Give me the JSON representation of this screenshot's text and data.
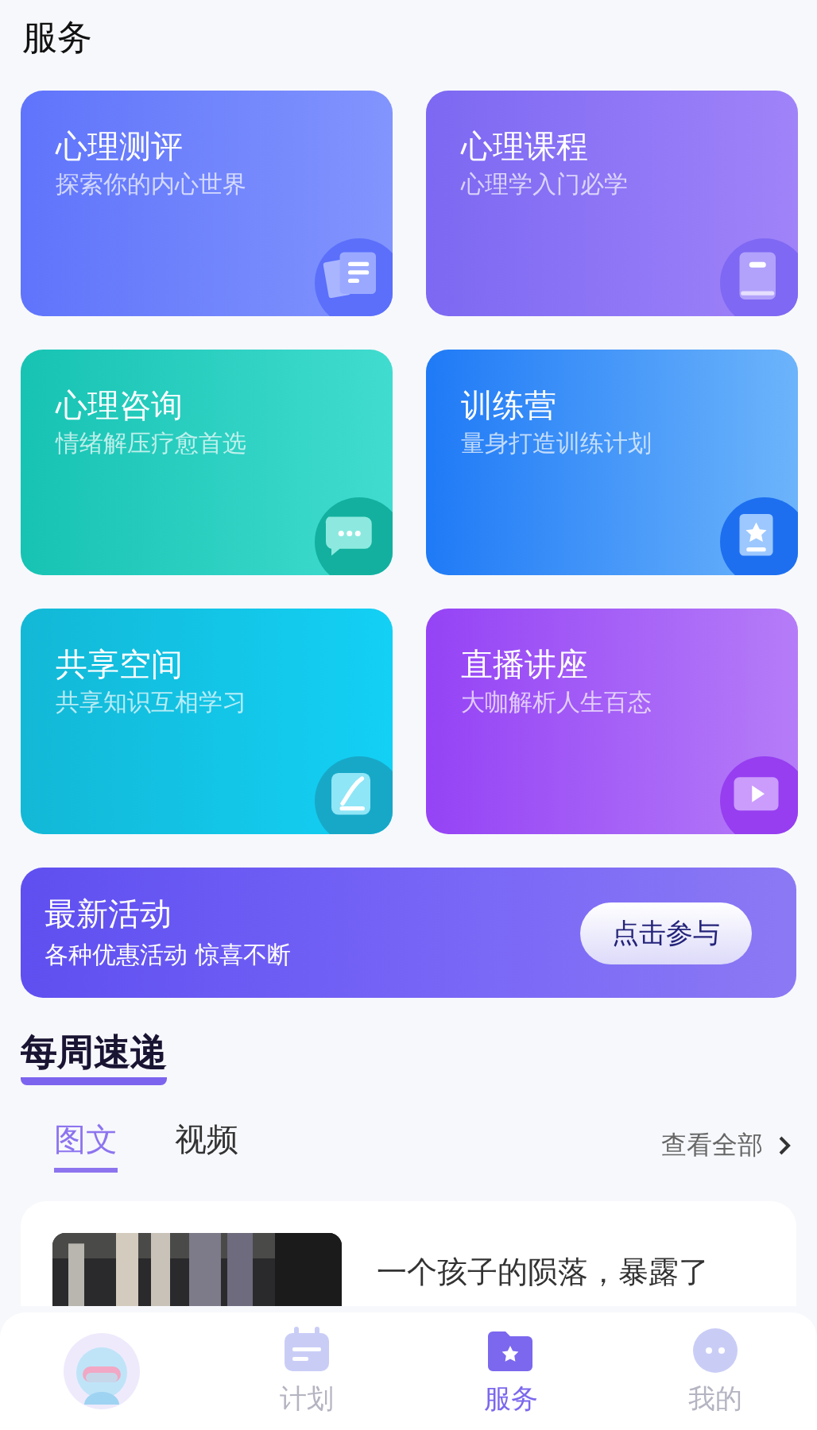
{
  "header": {
    "title": "服务"
  },
  "services": [
    {
      "kind": "test",
      "title": "心理测评",
      "subtitle": "探索你的内心世界"
    },
    {
      "kind": "course",
      "title": "心理课程",
      "subtitle": "心理学入门必学"
    },
    {
      "kind": "consult",
      "title": "心理咨询",
      "subtitle": "情绪解压疗愈首选"
    },
    {
      "kind": "camp",
      "title": "训练营",
      "subtitle": "量身打造训练计划"
    },
    {
      "kind": "share",
      "title": "共享空间",
      "subtitle": "共享知识互相学习"
    },
    {
      "kind": "live",
      "title": "直播讲座",
      "subtitle": "大咖解析人生百态"
    }
  ],
  "banner": {
    "title": "最新活动",
    "subtitle": "各种优惠活动 惊喜不断",
    "button": "点击参与"
  },
  "weekly": {
    "title": "每周速递",
    "tabs": [
      {
        "label": "图文",
        "selected": true
      },
      {
        "label": "视频",
        "selected": false
      }
    ],
    "view_all": "查看全部",
    "articles": [
      {
        "title": "一个孩子的陨落，暴露了"
      }
    ]
  },
  "nav": [
    {
      "kind": "avatar",
      "selected": false
    },
    {
      "kind": "plan",
      "label": "计划",
      "selected": false
    },
    {
      "kind": "service",
      "label": "服务",
      "selected": true
    },
    {
      "kind": "me",
      "label": "我的",
      "selected": false
    }
  ]
}
